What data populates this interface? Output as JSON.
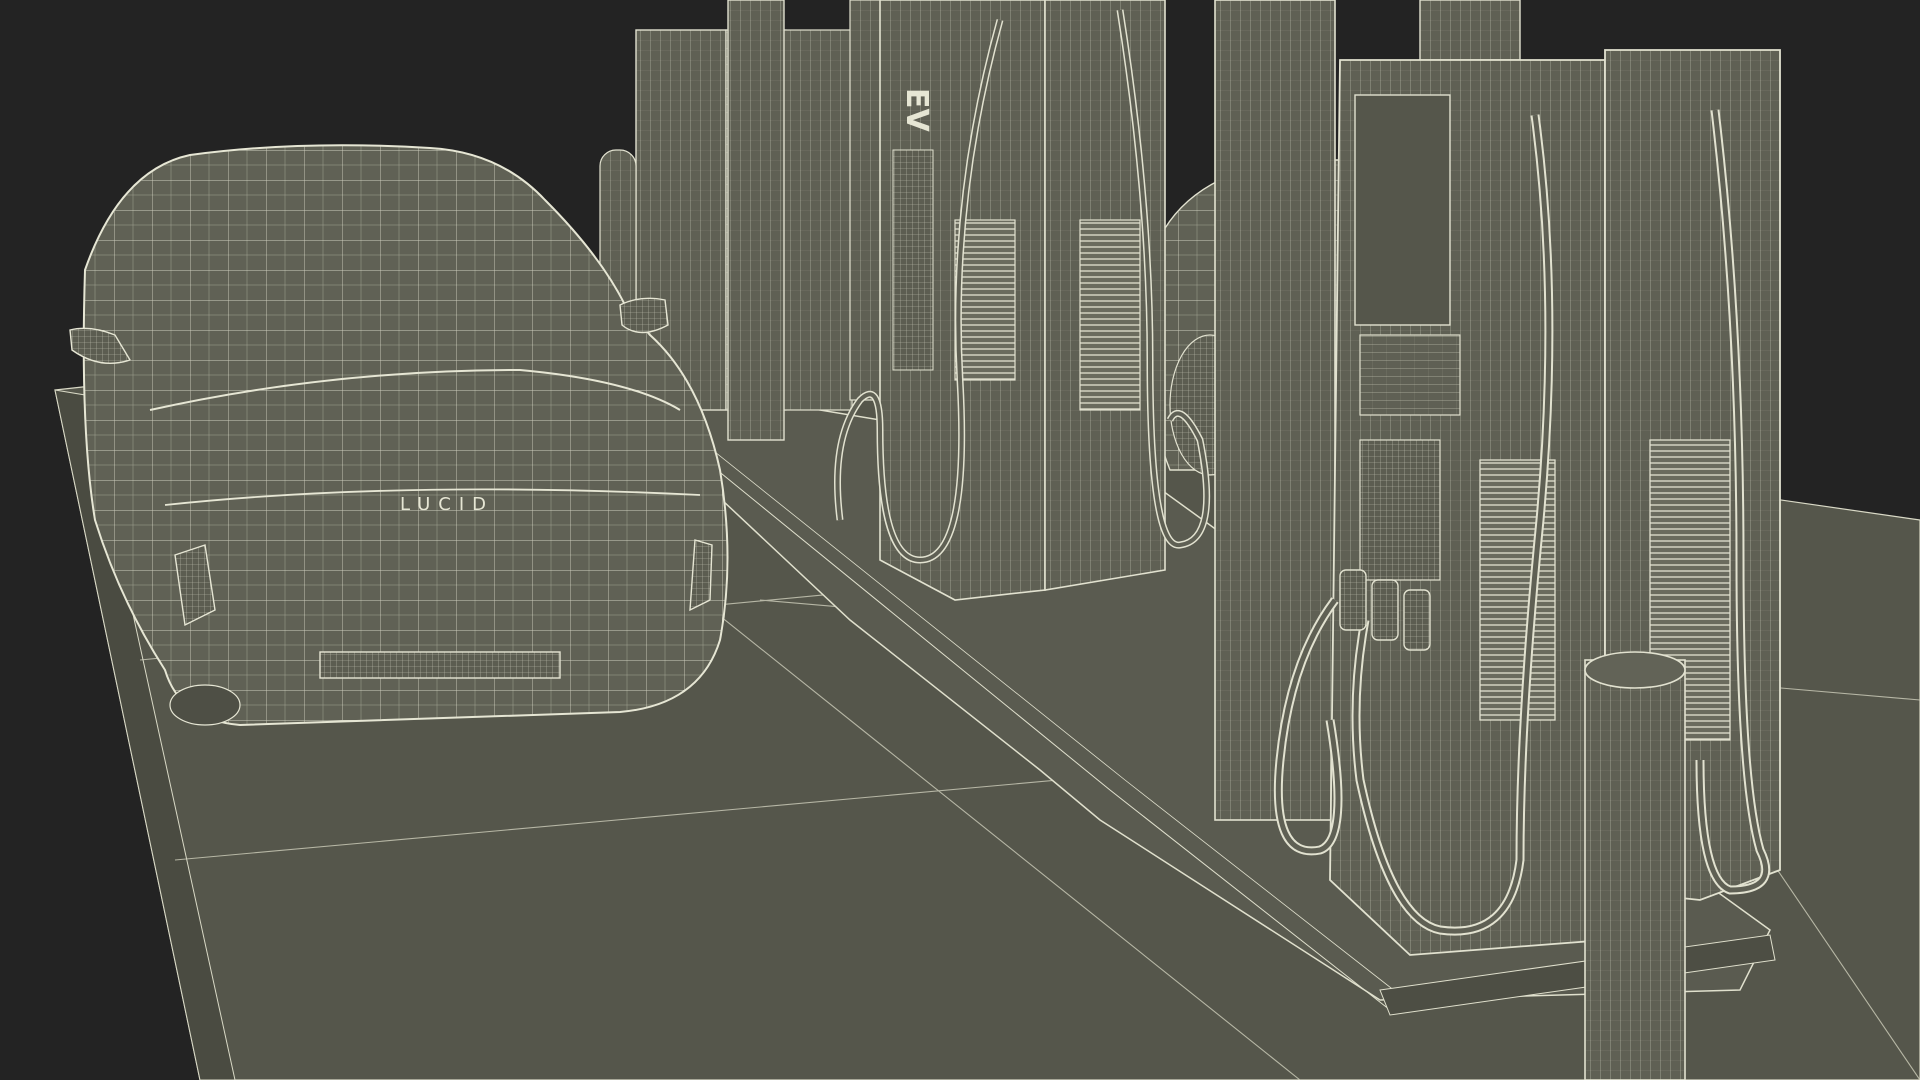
{
  "scene": {
    "background_color": "#232323",
    "mesh_fill_color": "#5f6054",
    "mesh_fill_dark": "#4e4f45",
    "wire_color": "#d9d9c6",
    "ground_color": "#55564b"
  },
  "vehicle": {
    "badge_text": "LUCID",
    "badge_icon": "car-wireframe-icon"
  },
  "chargers": {
    "front_label": "EV",
    "icon": "ev-charger-icon"
  }
}
